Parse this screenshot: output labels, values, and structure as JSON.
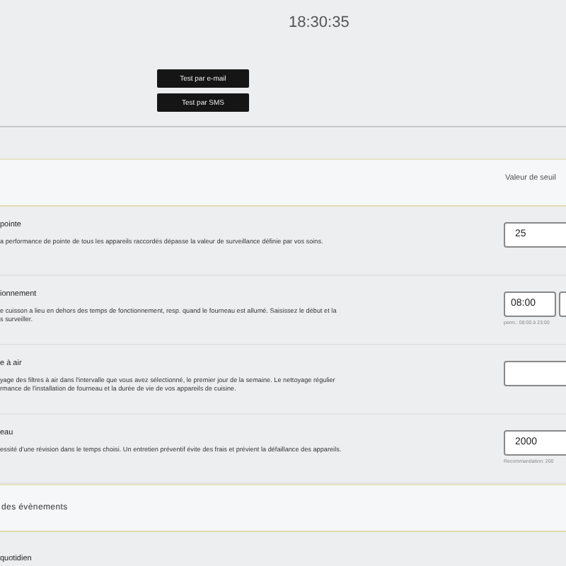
{
  "clock": "18:30:35",
  "test_buttons": [
    "Test par e-mail",
    "Test par SMS"
  ],
  "sections": [
    {
      "column_header": "Valeur de seuil",
      "rows": [
        {
          "title": "pointe",
          "description": [
            "a performance de pointe de tous les appareils raccordés dépasse la valeur de surveillance définie par vos soins."
          ],
          "kind": "number",
          "value": "25"
        },
        {
          "title": "ionnement",
          "description": [
            "e cuisson a lieu en dehors des temps de fonctionnement, resp. quand le fourneau est allumé. Saisissez le début et la",
            "s surveiller."
          ],
          "kind": "time",
          "value": "08:00",
          "hint": "perm.: 08:00 à 23:00"
        },
        {
          "title": "e à air",
          "description": [
            "yage des filtres à air dans l'intervalle que vous avez sélectionné, le premier jour de la semaine. Le nettoyage régulier",
            "rmance de l'installation de fourneau et la durée de vie de vos appareils de cuisine."
          ],
          "kind": "text"
        },
        {
          "title": "eau",
          "description": [
            "essité d'une révision dans le temps choisi. Un entretien préventif évite des frais et prévient la défaillance des appareils."
          ],
          "kind": "number",
          "value": "2000",
          "hint": "Recommandation: 200"
        }
      ]
    },
    {
      "title": "des évènements",
      "rows": [
        {
          "title": "quotidien",
          "kind": "none"
        }
      ]
    }
  ]
}
